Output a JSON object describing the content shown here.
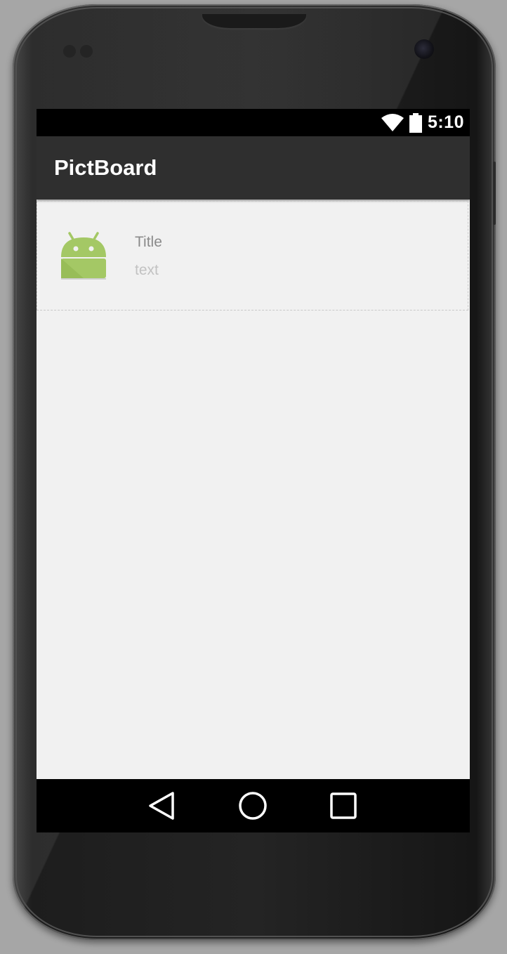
{
  "status_bar": {
    "time": "5:10",
    "icons": [
      "wifi-icon",
      "battery-icon"
    ]
  },
  "app_bar": {
    "title": "PictBoard"
  },
  "list": {
    "items": [
      {
        "icon": "android-icon",
        "title": "Title",
        "text": "text"
      }
    ]
  },
  "nav_bar": {
    "buttons": [
      "back-icon",
      "home-icon",
      "recents-icon"
    ]
  },
  "colors": {
    "app_bar": "#2f2f2f",
    "status_bar": "#000000",
    "screen_bg": "#f1f1f1",
    "android_green": "#a4c865",
    "title_text": "#8a8a8a",
    "secondary_text": "#c2c2c2"
  }
}
